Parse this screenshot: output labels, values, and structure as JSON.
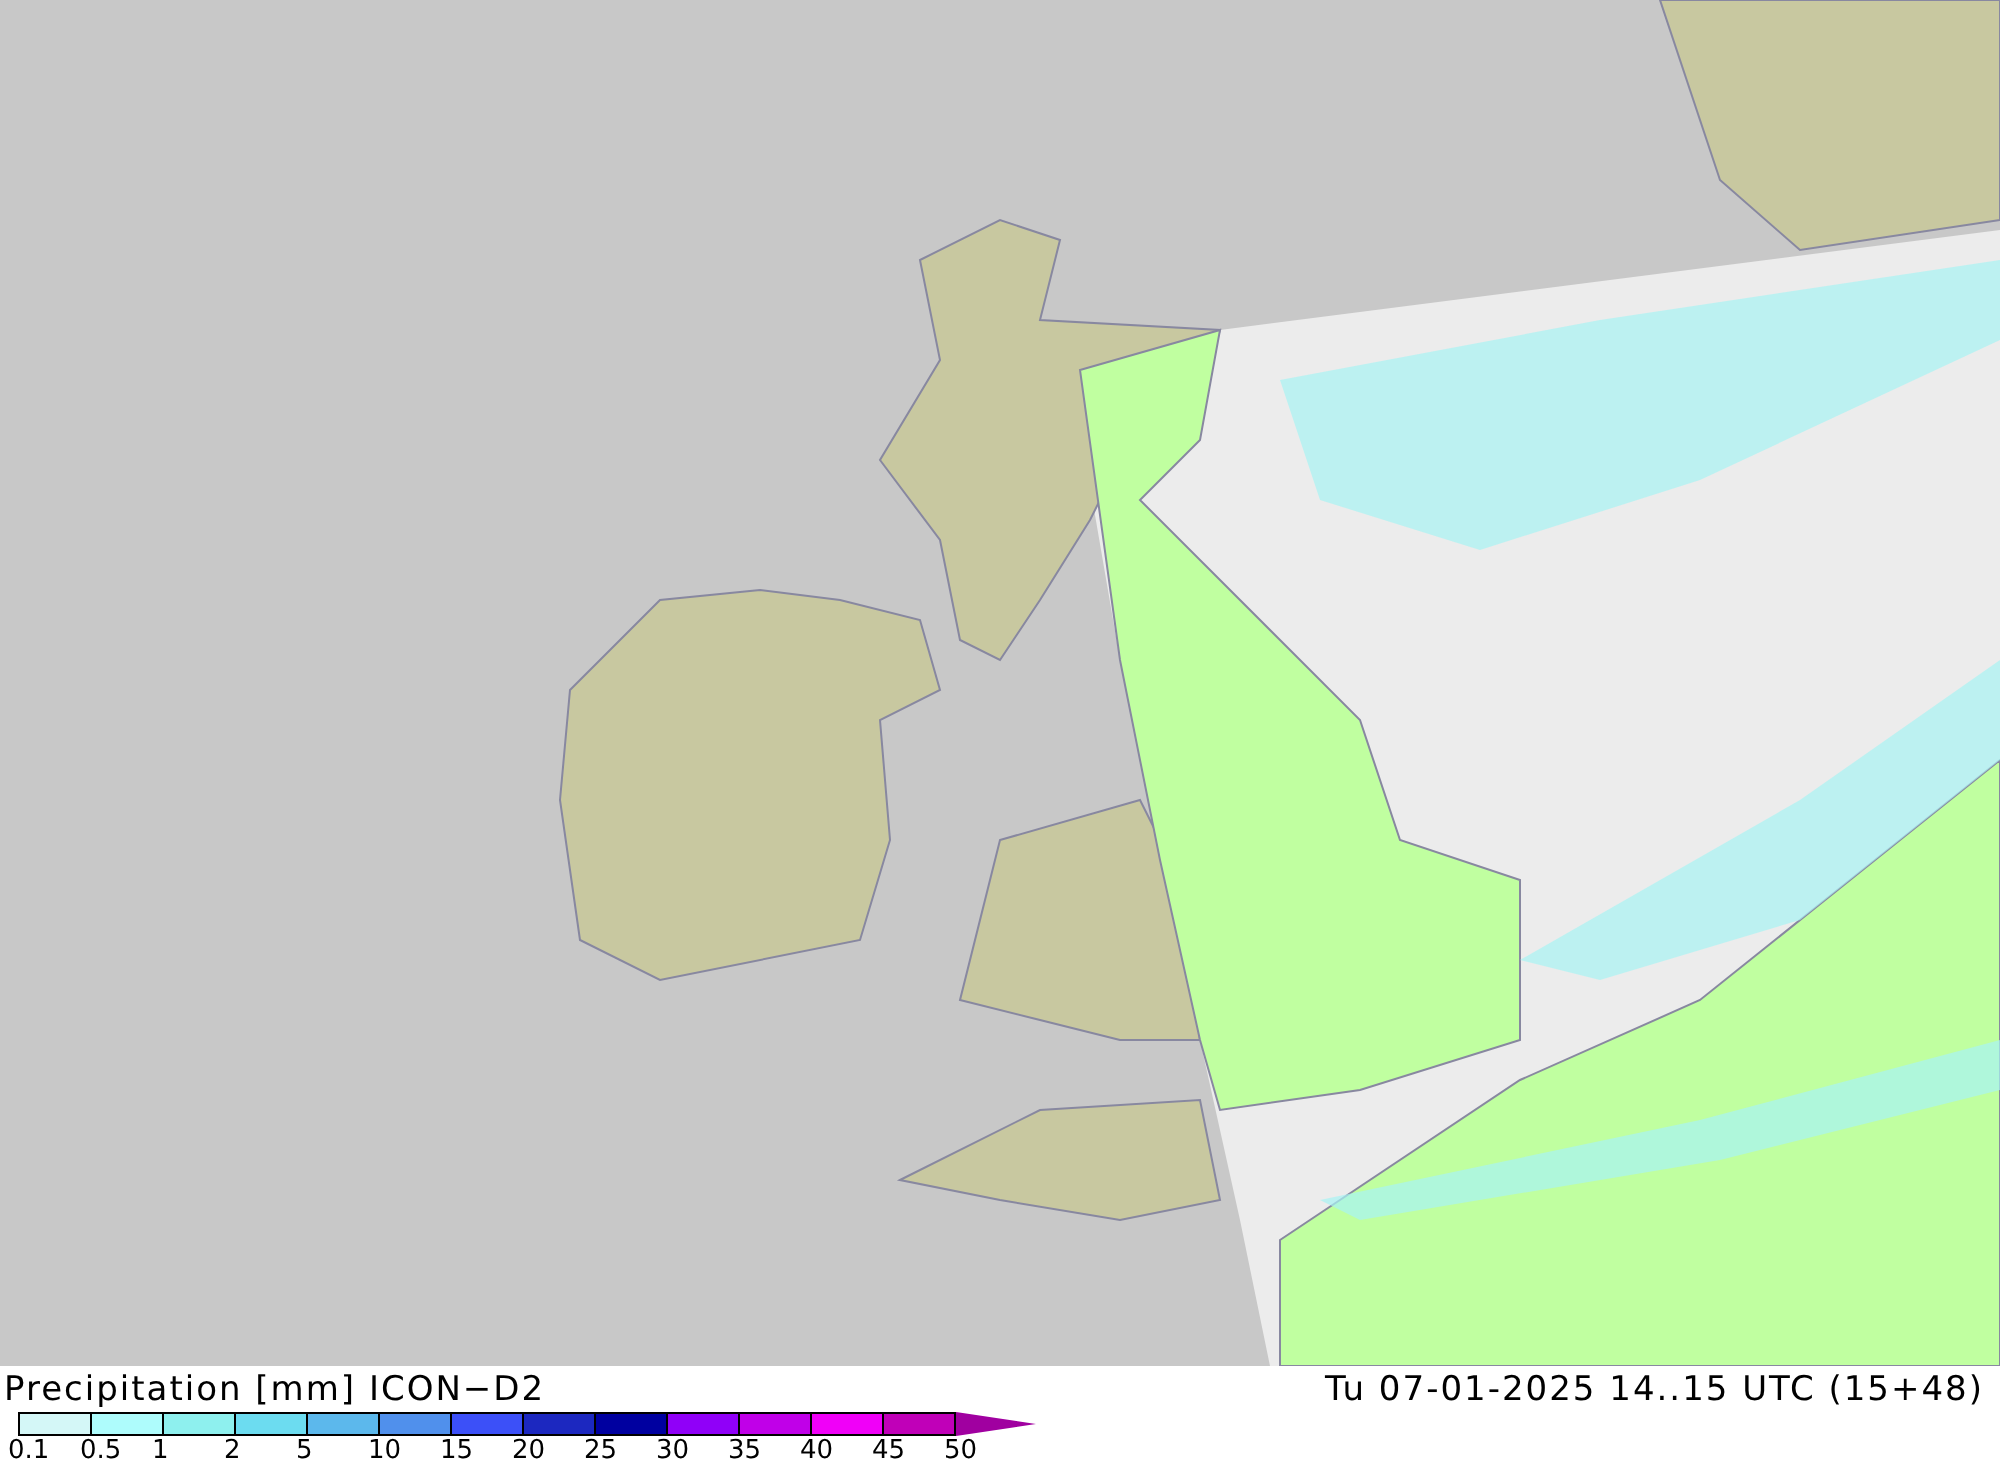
{
  "legend": {
    "title": "Precipitation [mm] ICON−D2",
    "valid_time": "Tu 07-01-2025 14..15 UTC (15+48)",
    "segments": [
      {
        "color": "#d4f7f7"
      },
      {
        "color": "#aefcfc"
      },
      {
        "color": "#8ef0ee"
      },
      {
        "color": "#6cdcf0"
      },
      {
        "color": "#5cb8ec"
      },
      {
        "color": "#5090ec"
      },
      {
        "color": "#3c50f8"
      },
      {
        "color": "#1c28c0"
      },
      {
        "color": "#0000a0"
      },
      {
        "color": "#9000f8"
      },
      {
        "color": "#c000e8"
      },
      {
        "color": "#f000f8"
      },
      {
        "color": "#c000b8"
      }
    ],
    "labels": [
      "0.1",
      "0.5",
      "1",
      "2",
      "5",
      "10",
      "15",
      "20",
      "25",
      "30",
      "35",
      "40",
      "45",
      "50"
    ]
  }
}
